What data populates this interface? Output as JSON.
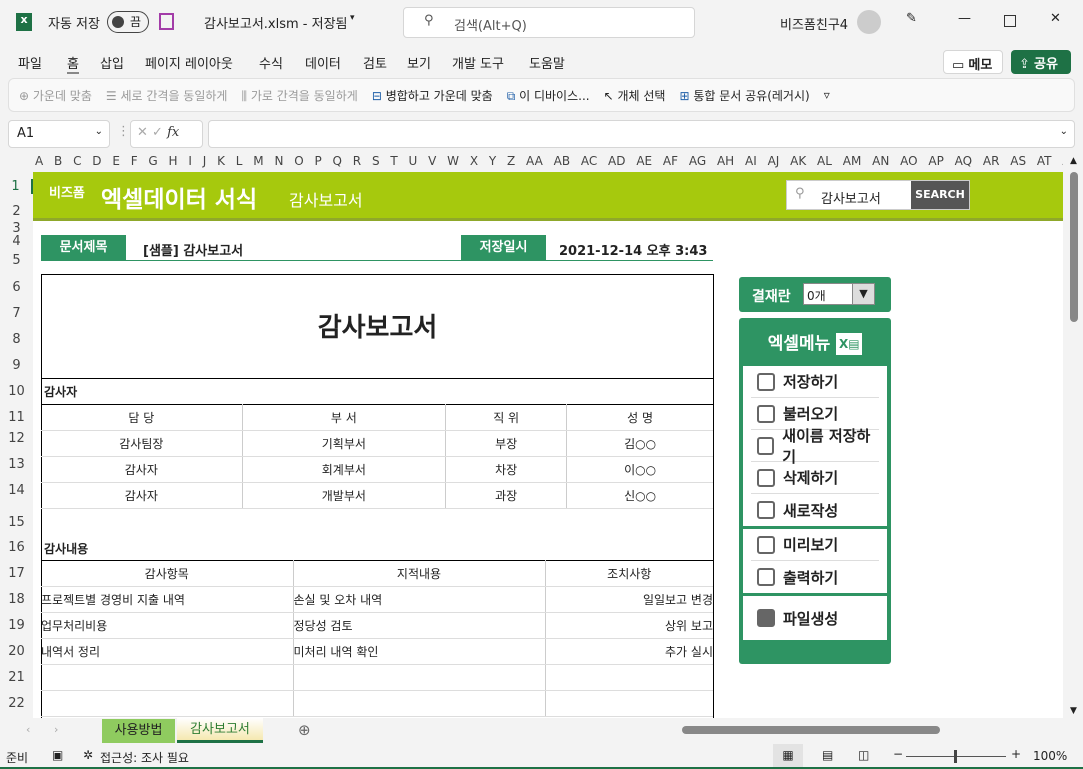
{
  "titlebar": {
    "autosave": "자동 저장",
    "toggle": "끔",
    "filename": "감사보고서.xlsm - 저장됨",
    "search": "검색(Alt+Q)",
    "user": "비즈폼친구4"
  },
  "menu": [
    "파일",
    "홈",
    "삽입",
    "페이지 레이아웃",
    "수식",
    "데이터",
    "검토",
    "보기",
    "개발 도구",
    "도움말"
  ],
  "menu_right": {
    "memo": "메모",
    "share": "공유"
  },
  "ribbon": [
    "가운데 맞춤",
    "세로 간격을 동일하게",
    "가로 간격을 동일하게",
    "병합하고 가운데 맞춤",
    "이 디바이스...",
    "개체 선택",
    "통합 문서 공유(레거시)"
  ],
  "formula": {
    "namebox": "A1",
    "fx": "fx",
    "value": ""
  },
  "columns": "A B C D E F G H I J K L M N O P Q R S T U V W X Y Z AA AB AC AD AE AF AG AH AI AJ AK AL AM AN AO AP AQ AR AS AT AU AV AW AX",
  "rows": [
    "1",
    "2",
    "3",
    "4",
    "5",
    "6",
    "7",
    "8",
    "9",
    "10",
    "11",
    "12",
    "13",
    "14",
    "15",
    "16",
    "17",
    "18",
    "19",
    "20",
    "21",
    "22"
  ],
  "banner": {
    "brand": "비즈폼",
    "title": "엑셀데이터 서식",
    "subtitle": "감사보고서",
    "search_value": "감사보고서",
    "search_btn": "SEARCH"
  },
  "docinfo": {
    "title_label": "문서제목",
    "title_value": "[샘플] 감사보고서",
    "date_label": "저장일시",
    "date_value": "2021-12-14  오후 3:43"
  },
  "doc": {
    "heading": "감사보고서",
    "auditors_label": "감사자",
    "auditors_headers": [
      "담 당",
      "부 서",
      "직 위",
      "성 명"
    ],
    "auditors": [
      [
        "감사팀장",
        "기획부서",
        "부장",
        "김○○"
      ],
      [
        "감사자",
        "회계부서",
        "차장",
        "이○○"
      ],
      [
        "감사자",
        "개발부서",
        "과장",
        "신○○"
      ]
    ],
    "content_label": "감사내용",
    "content_headers": [
      "감사항목",
      "지적내용",
      "조치사항"
    ],
    "content": [
      [
        "프로젝트별 경영비 지출 내역",
        "손실 및 오차 내역",
        "일일보고 변경"
      ],
      [
        "업무처리비용",
        "정당성 검토",
        "상위 보고"
      ],
      [
        "내역서 정리",
        "미처리 내역 확인",
        "추가 실시"
      ],
      [
        "",
        "",
        ""
      ],
      [
        "",
        "",
        ""
      ]
    ]
  },
  "approval": {
    "label": "결재란",
    "value": "0개"
  },
  "excel_menu": {
    "title": "엑셀메뉴",
    "group1": [
      "저장하기",
      "불러오기",
      "새이름 저장하기",
      "삭제하기",
      "새로작성"
    ],
    "group2": [
      "미리보기",
      "출력하기"
    ],
    "group3": [
      "파일생성"
    ]
  },
  "sheets": [
    "사용방법",
    "감사보고서"
  ],
  "status": {
    "ready": "준비",
    "accessibility": "접근성: 조사 필요",
    "zoom": "100%"
  },
  "colors": {
    "green": "#2e9463",
    "lime": "#a6c90d",
    "excel": "#1e7145"
  }
}
